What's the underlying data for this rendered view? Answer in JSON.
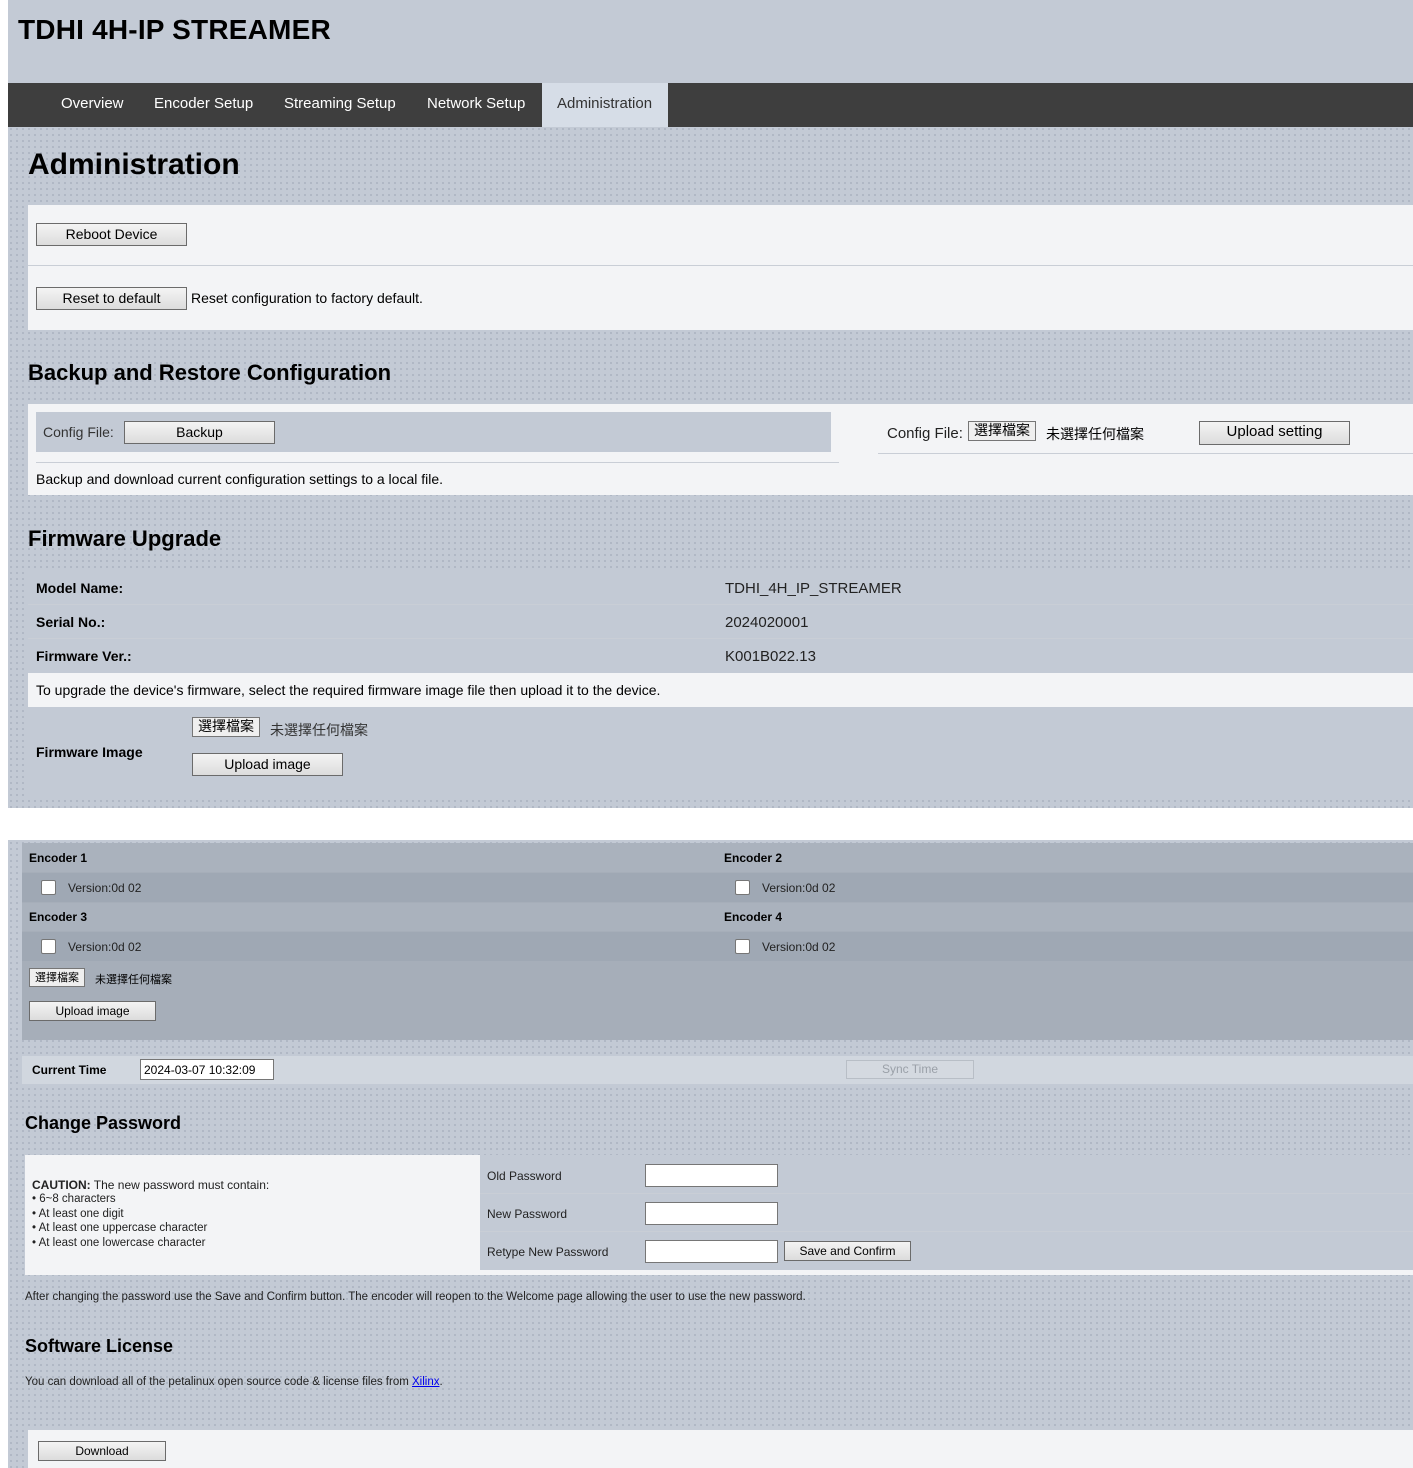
{
  "app_title": "TDHI 4H-IP STREAMER",
  "nav": {
    "tabs": [
      {
        "label": "Overview"
      },
      {
        "label": "Encoder Setup"
      },
      {
        "label": "Streaming Setup"
      },
      {
        "label": "Network Setup"
      },
      {
        "label": "Administration",
        "active": true
      }
    ]
  },
  "page_title": "Administration",
  "device": {
    "reboot_label": "Reboot Device",
    "reset_label": "Reset to default",
    "reset_desc": "Reset configuration to factory default."
  },
  "backup": {
    "heading": "Backup and Restore Configuration",
    "config_file_label": "Config File:",
    "backup_label": "Backup",
    "choose_file_label": "選擇檔案",
    "no_file_text": "未選擇任何檔案",
    "upload_setting_label": "Upload setting",
    "desc": "Backup and download current configuration settings to a local file."
  },
  "firmware": {
    "heading": "Firmware Upgrade",
    "rows": [
      {
        "label": "Model Name:",
        "value": "TDHI_4H_IP_STREAMER"
      },
      {
        "label": "Serial No.:",
        "value": "2024020001"
      },
      {
        "label": "Firmware Ver.:",
        "value": "K001B022.13"
      }
    ],
    "instructions": "To upgrade the device's firmware, select the required firmware image file then upload it to the device.",
    "image_label": "Firmware Image",
    "choose_file_label": "選擇檔案",
    "no_file_text": "未選擇任何檔案",
    "upload_label": "Upload image"
  },
  "encoders": {
    "items": [
      {
        "name": "Encoder 1",
        "version": "Version:0d 02"
      },
      {
        "name": "Encoder 2",
        "version": "Version:0d 02"
      },
      {
        "name": "Encoder 3",
        "version": "Version:0d 02"
      },
      {
        "name": "Encoder 4",
        "version": "Version:0d 02"
      }
    ],
    "choose_file_label": "選擇檔案",
    "no_file_text": "未選擇任何檔案",
    "upload_label": "Upload image"
  },
  "time": {
    "label": "Current Time",
    "value": "2024-03-07 10:32:09",
    "sync_label": "Sync Time"
  },
  "password": {
    "heading": "Change Password",
    "caution_bold": "CAUTION:",
    "caution_text": " The new password must contain:",
    "rules": [
      "• 6~8 characters",
      "• At least one digit",
      "• At least one uppercase character",
      "• At least one lowercase character"
    ],
    "old_label": "Old Password",
    "new_label": "New Password",
    "retype_label": "Retype New Password",
    "save_label": "Save and Confirm",
    "note": "After changing the password use the Save and Confirm button. The encoder will reopen to the Welcome page allowing the user to use the new password."
  },
  "license": {
    "heading": "Software License",
    "text": "You can download all of the petalinux open source code & license files from ",
    "link_text": "Xilinx",
    "link_suffix": ".",
    "download_label": "Download"
  }
}
